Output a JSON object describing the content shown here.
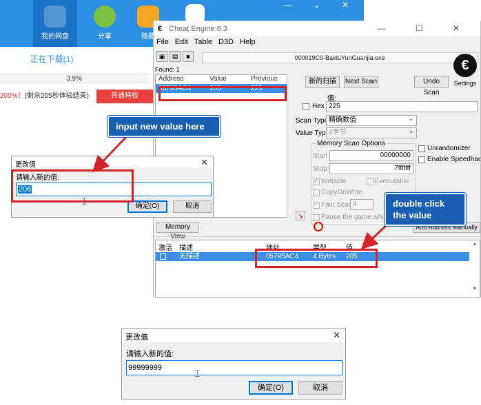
{
  "baidu": {
    "nav": [
      {
        "label": "我的网盘",
        "icon": "cloud-icon"
      },
      {
        "label": "分享",
        "icon": "share-icon"
      },
      {
        "label": "隐藏",
        "icon": "lock-icon"
      },
      {
        "label": "",
        "icon": "tools-icon"
      }
    ],
    "window_controls": "— ⌄ ✕",
    "tab_downloading": "正在下载(1)",
    "progress": "3.9%",
    "promo_prefix": "200%！",
    "promo_text": "(剩余205秒体验结束)",
    "vip_button": "开通特权"
  },
  "ce": {
    "title": "Cheat Engine 6.3",
    "window_controls": "—  ☐  ✕",
    "menu": [
      "File",
      "Edit",
      "Table",
      "D3D",
      "Help"
    ],
    "process": "000019C0-BaiduYunGuanjia.exe",
    "found": "Found: 1",
    "settings": "Settings",
    "results_columns": [
      "Address",
      "Value",
      "Previous"
    ],
    "results_row": {
      "address": "05795AC4",
      "value": "205",
      "previous": "225"
    },
    "new_scan": "新的扫描",
    "next_scan": "Next Scan",
    "undo_scan": "Undo Scan",
    "value_label": "值:",
    "hex_label": "Hex",
    "value_input": "225",
    "scan_type_label": "Scan Type",
    "scan_type_value": "精确数值",
    "value_type_label": "Value Type",
    "value_type_value": "4字节",
    "memory_scan_options": "Memory Scan Options",
    "start_label": "Start",
    "start_value": "00000000",
    "stop_label": "Stop",
    "stop_value": "7fffffff",
    "writable": "Writable",
    "executable": "Executable",
    "copy_on_write": "CopyOnWrite",
    "fast_scan": "Fast Scan",
    "fast_scan_value": "4",
    "pause_game": "Pause the game while sca",
    "unrandomizer": "Unrandomizer",
    "enable_speedhack": "Enable Speedhack",
    "memory_view": "Memory View",
    "add_address": "Add Address Manually",
    "list_columns": [
      "激活",
      "描述",
      "地址",
      "类型",
      "值"
    ],
    "list_row": {
      "description": "无描述",
      "address": "05795AC4",
      "type": "4 Bytes",
      "value": "205"
    }
  },
  "dialog1": {
    "title": "更改值",
    "prompt": "请输入新的值:",
    "value": "206",
    "ok": "确定(O)",
    "cancel": "取消"
  },
  "dialog2": {
    "title": "更改值",
    "prompt": "请输入新的值:",
    "value": "99999999",
    "ok": "确定(O)",
    "cancel": "取消"
  },
  "callouts": {
    "input_new_value": "input new value here",
    "double_click": "double click the value"
  },
  "colors": {
    "accent_red": "#d3232a",
    "callout_blue": "#1b5fb3",
    "selection_blue": "#3b8fe3",
    "baidu_blue": "#2d8fe0"
  }
}
